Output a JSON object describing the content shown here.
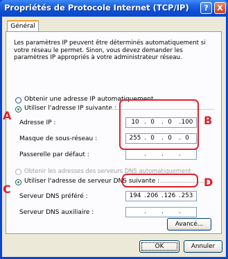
{
  "window": {
    "title": "Propriétés de Protocole Internet (TCP/IP)",
    "help_glyph": "?",
    "close_glyph": "X"
  },
  "tab": {
    "label": "Général"
  },
  "intro": "Les paramètres IP peuvent être déterminés automatiquement si votre réseau le permet. Sinon, vous devez demander les paramètres IP appropriés à votre administrateur réseau.",
  "ip": {
    "auto_label": "Obtenir une adresse IP automatiquement",
    "manual_label": "Utiliser l'adresse IP suivante :",
    "address_label": "Adresse IP :",
    "address": [
      "10",
      "0",
      "0",
      "100"
    ],
    "mask_label": "Masque de sous-réseau :",
    "mask": [
      "255",
      "0",
      "0",
      "0"
    ],
    "gateway_label": "Passerelle par défaut :",
    "gateway": [
      "",
      "",
      "",
      ""
    ]
  },
  "dns": {
    "auto_label": "Obtenir les adresses des serveurs DNS automatiquement",
    "manual_label": "Utiliser l'adresse de serveur DNS suivante :",
    "preferred_label": "Serveur DNS préféré :",
    "preferred": [
      "194",
      "206",
      "126",
      "253"
    ],
    "alternate_label": "Serveur DNS auxiliaire :",
    "alternate": [
      "",
      "",
      "",
      ""
    ]
  },
  "buttons": {
    "advanced": "Avancé...",
    "ok": "OK",
    "cancel": "Annuler"
  },
  "annotations": {
    "a": "A",
    "b": "B",
    "c": "C",
    "d": "D"
  },
  "colors": {
    "title_bar": "#0a4ed8",
    "annotation_red": "#e0202c",
    "dialog_bg": "#ece9d8"
  }
}
